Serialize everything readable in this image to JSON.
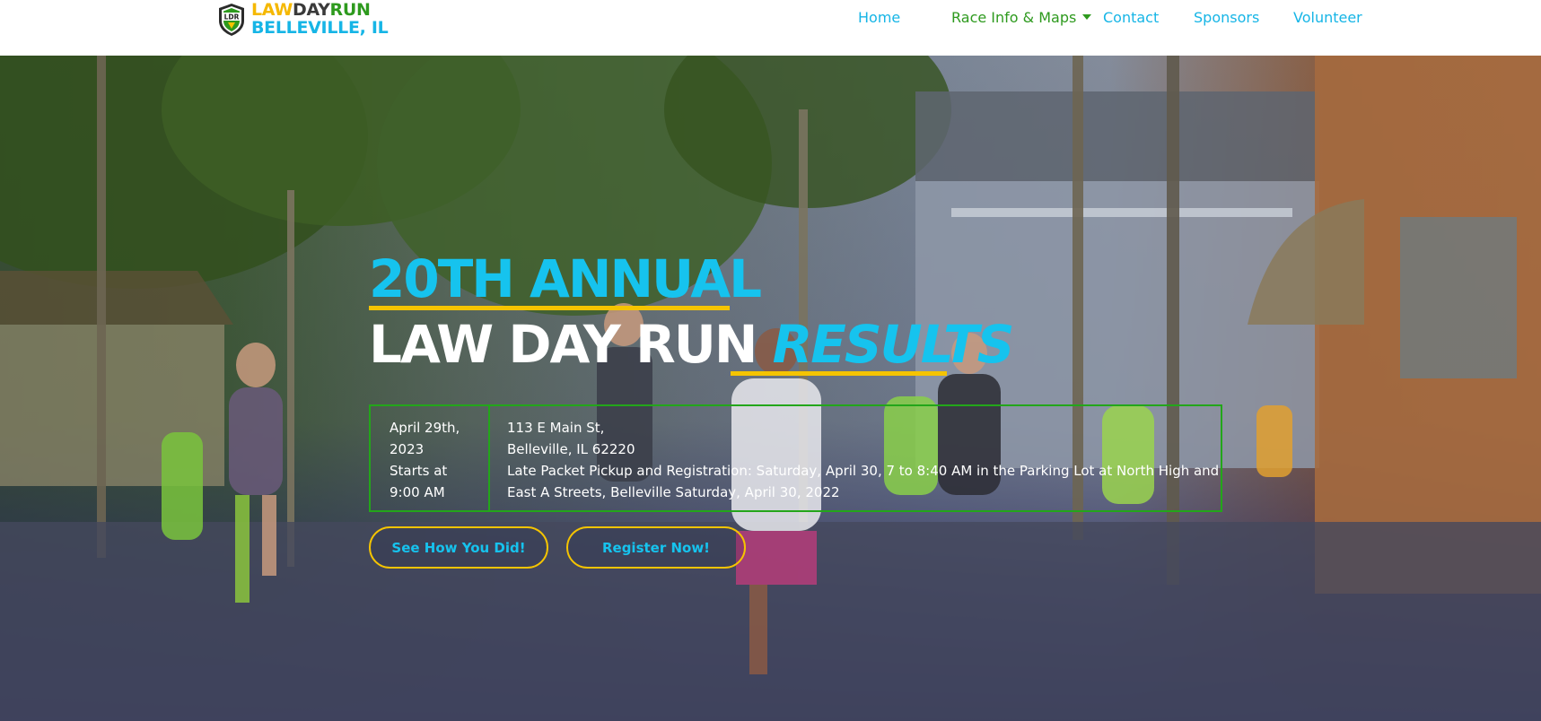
{
  "brand": {
    "badge_text": "LDR",
    "line1_law": "LAW",
    "line1_day": "DAY",
    "line1_run": "RUN",
    "line2": "BELLEVILLE, IL"
  },
  "nav": {
    "items": [
      {
        "label": "Home"
      },
      {
        "label": "Race Info & Maps"
      },
      {
        "label": "Contact"
      },
      {
        "label": "Sponsors"
      },
      {
        "label": "Volunteer"
      }
    ]
  },
  "hero": {
    "title_line1": "20TH ANNUAL",
    "title_line2_plain": "LAW DAY RUN ",
    "title_line2_accent": "RESULTS",
    "date_lines": [
      "April 29th,",
      "2023",
      "Starts at",
      "9:00 AM"
    ],
    "location_lines": [
      "113 E Main St,",
      "Belleville, IL 62220",
      "Late Packet Pickup and Registration: Saturday, April 30, 7 to 8:40 AM in the Parking Lot at North High and",
      "East A Streets, Belleville Saturday, April 30, 2022"
    ],
    "results_button": "See How You Did!",
    "register_button": "Register Now!"
  },
  "colors": {
    "brand_blue": "#16b5e6",
    "brand_green": "#2e9a1e",
    "brand_yellow": "#f5c400",
    "box_border": "#23a61a"
  }
}
